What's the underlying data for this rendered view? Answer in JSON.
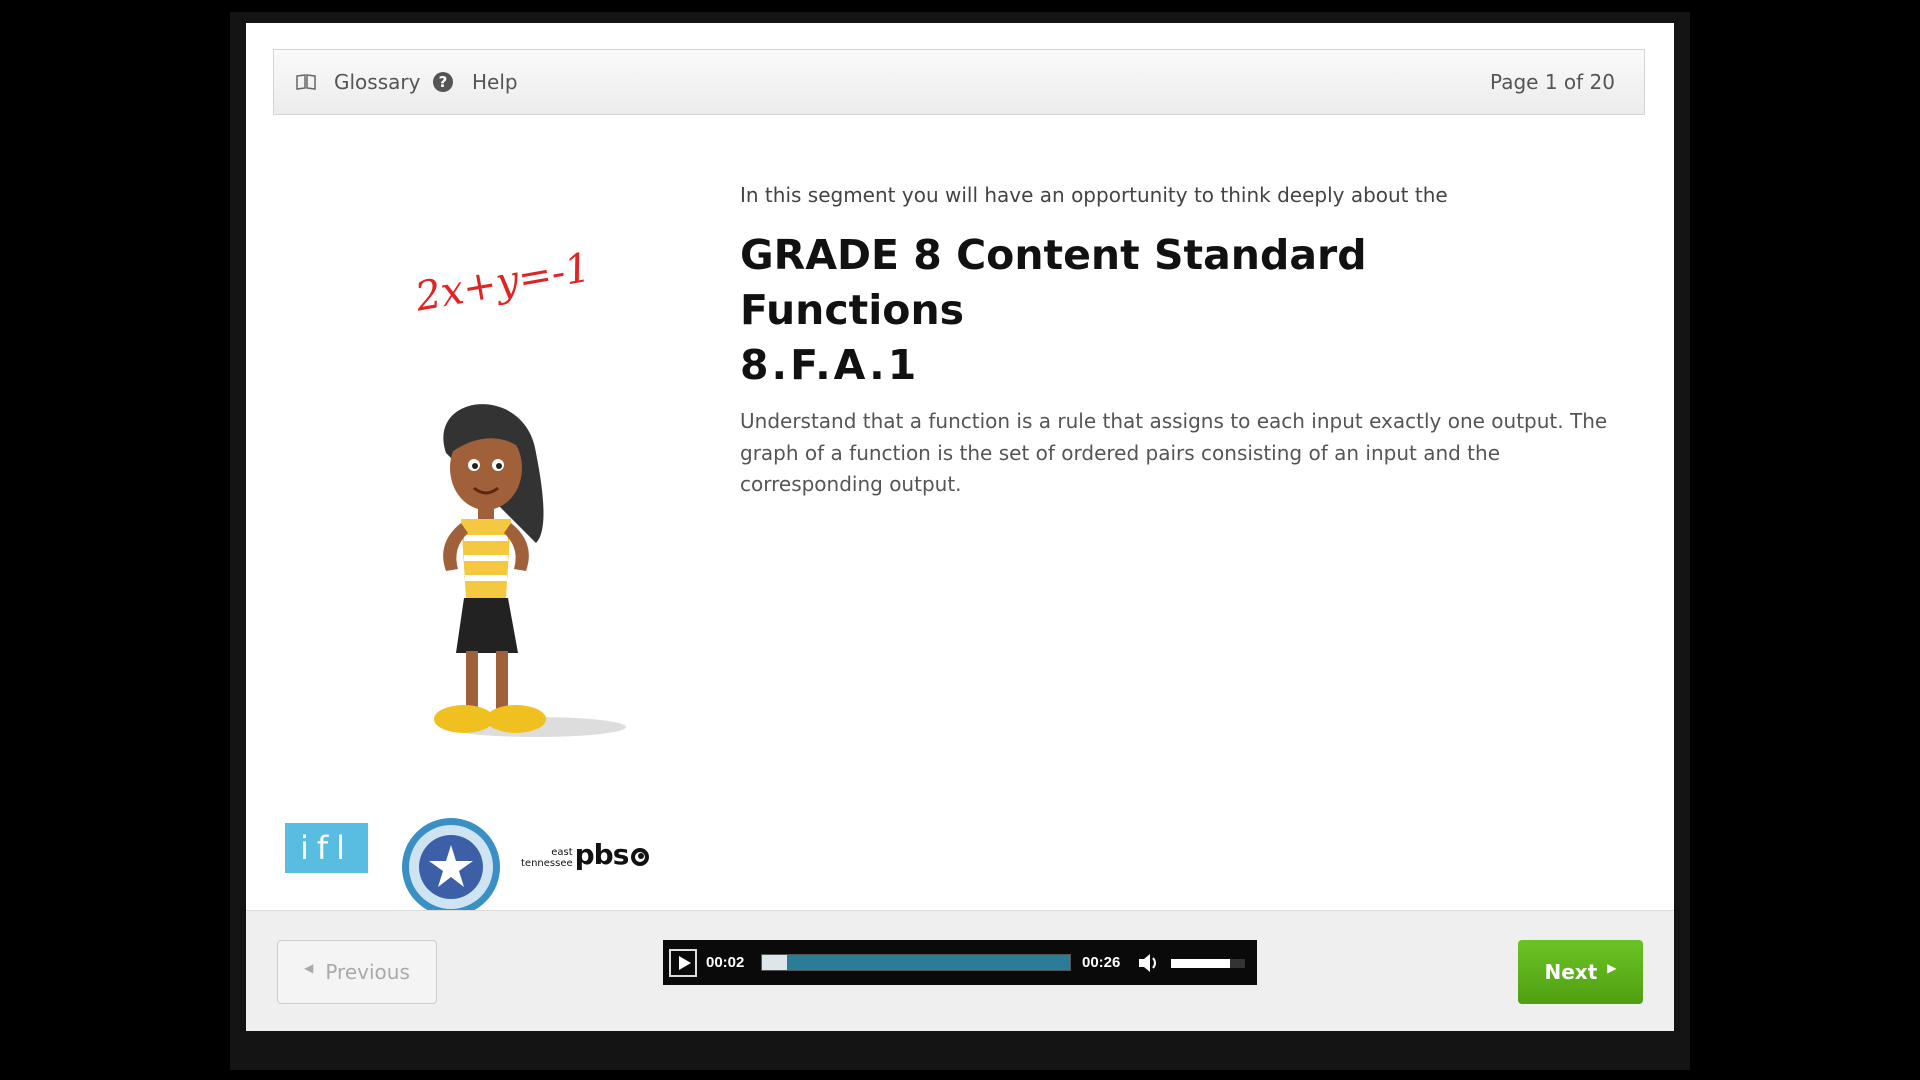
{
  "topbar": {
    "glossary": {
      "label": "Glossary",
      "icon": "book-icon"
    },
    "help": {
      "label": "Help",
      "icon": "question-circle-icon"
    },
    "page_indicator": "Page 1 of 20"
  },
  "content": {
    "intro": "In this segment you will have an opportunity to think deeply about the",
    "title_line1": "GRADE 8 Content Standard",
    "title_line2": "Functions",
    "title_line3": "8.F.A.1",
    "description": "Understand that a function is a rule that assigns to each input exactly one output. The graph of a function is the set of ordered pairs consisting of an input and the corresponding output.",
    "equation": "2x+y=-1"
  },
  "logos": {
    "ifl": "ifl",
    "pbs_small_top": "east",
    "pbs_small_bottom": "tennessee",
    "pbs_big": "pbs"
  },
  "navigation": {
    "previous_label": "Previous",
    "next_label": "Next"
  },
  "player": {
    "current_time": "00:02",
    "total_time": "00:26",
    "progress_fraction": 0.08,
    "volume_fraction": 0.8
  },
  "colors": {
    "next_button": "#5cb11b",
    "progress_track": "#2a7d97",
    "equation": "#e02424",
    "ifl_logo": "#58bde0"
  }
}
